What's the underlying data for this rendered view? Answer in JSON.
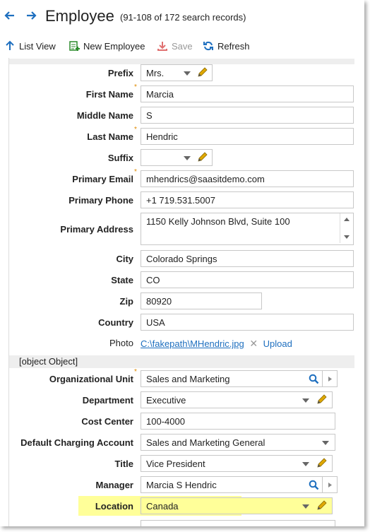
{
  "header": {
    "back_icon": "arrow-left-icon",
    "forward_icon": "arrow-right-icon",
    "title": "Employee",
    "subtitle": "(91-108 of 172 search records)"
  },
  "toolbar": {
    "list_view": "List View",
    "new_employee": "New Employee",
    "save": "Save",
    "refresh": "Refresh"
  },
  "form": {
    "prefix": {
      "label": "Prefix",
      "value": "Mrs."
    },
    "first_name": {
      "label": "First Name",
      "value": "Marcia"
    },
    "middle_name": {
      "label": "Middle Name",
      "value": "S"
    },
    "last_name": {
      "label": "Last Name",
      "value": "Hendric"
    },
    "suffix": {
      "label": "Suffix",
      "value": ""
    },
    "primary_email": {
      "label": "Primary Email",
      "value": "mhendrics@saasitdemo.com"
    },
    "primary_phone": {
      "label": "Primary Phone",
      "value": "+1 719.531.5007"
    },
    "primary_address": {
      "label": "Primary Address",
      "value": "1150 Kelly Johnson Blvd, Suite 100"
    },
    "city": {
      "label": "City",
      "value": "Colorado Springs"
    },
    "state": {
      "label": "State",
      "value": "CO"
    },
    "zip": {
      "label": "Zip",
      "value": "80920"
    },
    "country": {
      "label": "Country",
      "value": "USA"
    },
    "photo": {
      "label": "Photo",
      "value": "C:\\fakepath\\MHendric.jpg",
      "upload": "Upload"
    }
  },
  "org_section": {
    "title": {
      "label": "Title",
      "value": "Vice President"
    },
    "org_unit": {
      "label": "Organizational Unit",
      "value": "Sales and Marketing"
    },
    "department": {
      "label": "Department",
      "value": "Executive"
    },
    "cost_center": {
      "label": "Cost Center",
      "value": "100-4000"
    },
    "charging_account": {
      "label": "Default Charging Account",
      "value": "Sales and Marketing General"
    },
    "manager": {
      "label": "Manager",
      "value": "Marcia S Hendric"
    },
    "location": {
      "label": "Location",
      "value": "Canada"
    }
  },
  "colors": {
    "accent": "#1e6fbf",
    "required": "#e08a00",
    "highlight": "#ffff99",
    "pencil": "#e0a800"
  }
}
